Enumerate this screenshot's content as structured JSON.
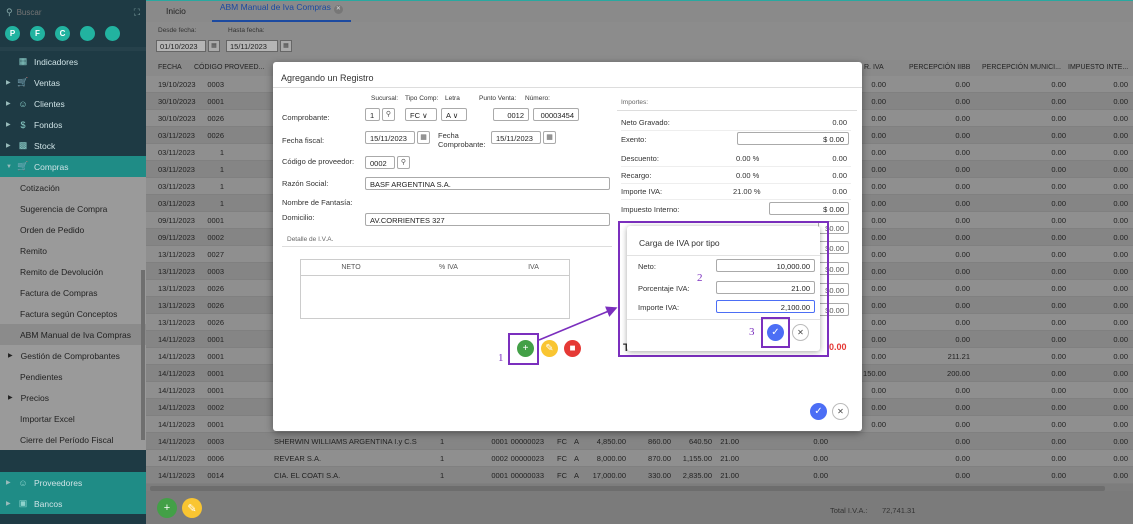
{
  "sidebar": {
    "search_placeholder": "Buscar",
    "circles": [
      "P",
      "F",
      "C",
      "",
      ""
    ],
    "items": [
      {
        "label": "Indicadores",
        "icon": "grid-icon"
      },
      {
        "label": "Ventas",
        "icon": "cart-icon"
      },
      {
        "label": "Clientes",
        "icon": "users-icon"
      },
      {
        "label": "Fondos",
        "icon": "dollar-icon"
      },
      {
        "label": "Stock",
        "icon": "building-icon"
      },
      {
        "label": "Compras",
        "icon": "cart-icon"
      }
    ],
    "sub_items": [
      "Cotización",
      "Sugerencia de Compra",
      "Orden de Pedido",
      "Remito",
      "Remito de Devolución",
      "Factura de Compras",
      "Factura según Conceptos",
      "ABM Manual de Iva Compras",
      "Gestión de Comprobantes",
      "Pendientes",
      "Precios",
      "Importar Excel",
      "Cierre del Período Fiscal"
    ],
    "bottom_items": [
      {
        "label": "Proveedores",
        "icon": "users-icon"
      },
      {
        "label": "Bancos",
        "icon": "bank-icon"
      }
    ]
  },
  "tabs": {
    "home": "Inicio",
    "active": "ABM Manual de Iva Compras"
  },
  "filters": {
    "desde_label": "Desde fecha:",
    "desde_value": "01/10/2023",
    "hasta_label": "Hasta fecha:",
    "hasta_value": "15/11/2023"
  },
  "grid": {
    "headers": [
      "FECHA",
      "CÓDIGO PROVEED...",
      "R. IVA",
      "PERCEPCIÓN IIBB",
      "PERCEPCIÓN MUNICI...",
      "IMPUESTO INTE..."
    ],
    "rows": [
      {
        "fecha": "19/10/2023",
        "cod": "0003",
        "riva": "0.00",
        "iibb": "0.00",
        "muni": "0.00",
        "imp": "0.00"
      },
      {
        "fecha": "30/10/2023",
        "cod": "0001",
        "riva": "0.00",
        "iibb": "0.00",
        "muni": "0.00",
        "imp": "0.00"
      },
      {
        "fecha": "30/10/2023",
        "cod": "0026",
        "riva": "0.00",
        "iibb": "0.00",
        "muni": "0.00",
        "imp": "0.00"
      },
      {
        "fecha": "03/11/2023",
        "cod": "0026",
        "riva": "0.00",
        "iibb": "0.00",
        "muni": "0.00",
        "imp": "0.00"
      },
      {
        "fecha": "03/11/2023",
        "cod": "1",
        "riva": "0.00",
        "iibb": "0.00",
        "muni": "0.00",
        "imp": "0.00"
      },
      {
        "fecha": "03/11/2023",
        "cod": "1",
        "riva": "0.00",
        "iibb": "0.00",
        "muni": "0.00",
        "imp": "0.00"
      },
      {
        "fecha": "03/11/2023",
        "cod": "1",
        "riva": "0.00",
        "iibb": "0.00",
        "muni": "0.00",
        "imp": "0.00"
      },
      {
        "fecha": "03/11/2023",
        "cod": "1",
        "riva": "0.00",
        "iibb": "0.00",
        "muni": "0.00",
        "imp": "0.00"
      },
      {
        "fecha": "09/11/2023",
        "cod": "0001",
        "riva": "0.00",
        "iibb": "0.00",
        "muni": "0.00",
        "imp": "0.00"
      },
      {
        "fecha": "09/11/2023",
        "cod": "0002",
        "riva": "0.00",
        "iibb": "0.00",
        "muni": "0.00",
        "imp": "0.00"
      },
      {
        "fecha": "13/11/2023",
        "cod": "0027",
        "riva": "0.00",
        "iibb": "0.00",
        "muni": "0.00",
        "imp": "0.00"
      },
      {
        "fecha": "13/11/2023",
        "cod": "0003",
        "riva": "0.00",
        "iibb": "0.00",
        "muni": "0.00",
        "imp": "0.00"
      },
      {
        "fecha": "13/11/2023",
        "cod": "0026",
        "riva": "0.00",
        "iibb": "0.00",
        "muni": "0.00",
        "imp": "0.00"
      },
      {
        "fecha": "13/11/2023",
        "cod": "0026",
        "riva": "0.00",
        "iibb": "0.00",
        "muni": "0.00",
        "imp": "0.00"
      },
      {
        "fecha": "13/11/2023",
        "cod": "0026",
        "riva": "0.00",
        "iibb": "0.00",
        "muni": "0.00",
        "imp": "0.00"
      },
      {
        "fecha": "14/11/2023",
        "cod": "0001",
        "riva": "0.00",
        "iibb": "0.00",
        "muni": "0.00",
        "imp": "0.00"
      },
      {
        "fecha": "14/11/2023",
        "cod": "0001",
        "riva": "0.00",
        "iibb": "211.21",
        "muni": "0.00",
        "imp": "0.00"
      },
      {
        "fecha": "14/11/2023",
        "cod": "0001",
        "riva": "150.00",
        "iibb": "200.00",
        "muni": "0.00",
        "imp": "0.00"
      },
      {
        "fecha": "14/11/2023",
        "cod": "0001",
        "riva": "0.00",
        "iibb": "0.00",
        "muni": "0.00",
        "imp": "0.00"
      },
      {
        "fecha": "14/11/2023",
        "cod": "0002",
        "riva": "0.00",
        "iibb": "0.00",
        "muni": "0.00",
        "imp": "0.00"
      },
      {
        "fecha": "14/11/2023",
        "cod": "0001",
        "riva": "0.00",
        "iibb": "0.00",
        "muni": "0.00",
        "imp": "0.00"
      }
    ],
    "visible_rows": [
      {
        "fecha": "14/11/2023",
        "cod": "0003",
        "razon": "SHERWIN WILLIAMS ARGENTINA I.y C.S",
        "n1": "1",
        "pv": "0001",
        "num": "00000023",
        "tipo": "FC",
        "letra": "A",
        "neto": "4,850.00",
        "c1": "860.00",
        "c2": "640.50",
        "c3": "21.00",
        "c4": "0.00",
        "iibb": "0.00",
        "muni": "0.00",
        "imp": "0.00"
      },
      {
        "fecha": "14/11/2023",
        "cod": "0006",
        "razon": "REVEAR S.A.",
        "n1": "1",
        "pv": "0002",
        "num": "00000023",
        "tipo": "FC",
        "letra": "A",
        "neto": "8,000.00",
        "c1": "870.00",
        "c2": "1,155.00",
        "c3": "21.00",
        "c4": "0.00",
        "iibb": "0.00",
        "muni": "0.00",
        "imp": "0.00"
      },
      {
        "fecha": "14/11/2023",
        "cod": "0014",
        "razon": "CIA. EL COATI S.A.",
        "n1": "1",
        "pv": "0001",
        "num": "00000033",
        "tipo": "FC",
        "letra": "A",
        "neto": "17,000.00",
        "c1": "330.00",
        "c2": "2,835.00",
        "c3": "21.00",
        "c4": "0.00",
        "iibb": "0.00",
        "muni": "0.00",
        "imp": "0.00"
      }
    ],
    "total_label": "Total I.V.A.:",
    "total_value": "72,741.31"
  },
  "modal": {
    "title": "Agregando un Registro",
    "comprobante_label": "Comprobante:",
    "sucursal_label": "Sucursal:",
    "sucursal": "1",
    "tipo_comp_label": "Tipo Comp:",
    "tipo_comp": "FC",
    "letra_label": "Letra",
    "letra": "A",
    "punto_venta_label": "Punto Venta:",
    "punto_venta": "0012",
    "numero_label": "Número:",
    "numero": "00003454",
    "fecha_fiscal_label": "Fecha fiscal:",
    "fecha_fiscal": "15/11/2023",
    "fecha_comp_label": "Fecha Comprobante:",
    "fecha_comp": "15/11/2023",
    "cod_prov_label": "Código de proveedor:",
    "cod_prov": "0002",
    "razon_label": "Razón Social:",
    "razon": "BASF ARGENTINA S.A.",
    "fantasia_label": "Nombre de Fantasía:",
    "fantasia": "",
    "domicilio_label": "Domicilio:",
    "domicilio": "AV.CORRIENTES 327",
    "detalle_label": "Detalle de I.V.A.",
    "detalle_headers": [
      "NETO",
      "% IVA",
      "IVA"
    ],
    "importes_label": "Importes:",
    "importes": [
      {
        "label": "Neto Gravado:",
        "pct": "",
        "value": "0.00"
      },
      {
        "label": "Exento:",
        "pct": "",
        "value": "$ 0.00"
      },
      {
        "label": "Descuento:",
        "pct": "0.00 %",
        "value": "0.00"
      },
      {
        "label": "Recargo:",
        "pct": "0.00 %",
        "value": "0.00"
      },
      {
        "label": "Importe IVA:",
        "pct": "21.00 %",
        "value": "0.00"
      },
      {
        "label": "Impuesto Interno:",
        "pct": "",
        "value": "$ 0.00"
      }
    ],
    "hidden_values": [
      "$0.00",
      "$0.00",
      "$0.00",
      "$0.00",
      "$0.00"
    ],
    "total_prefix": "To",
    "total_value": "0.00"
  },
  "popup": {
    "title": "Carga de IVA por tipo",
    "neto_label": "Neto:",
    "neto": "10,000.00",
    "pct_label": "Porcentaje IVA:",
    "pct": "21.00",
    "importe_label": "Importe IVA:",
    "importe": "2,100.00"
  },
  "annotations": [
    "1",
    "2",
    "3"
  ],
  "colors": {
    "accent": "#7b2fbe",
    "teal": "#22b3a0",
    "primary": "#4c6ef5",
    "green": "#43a047",
    "yellow": "#f9c531",
    "red": "#e53935"
  }
}
